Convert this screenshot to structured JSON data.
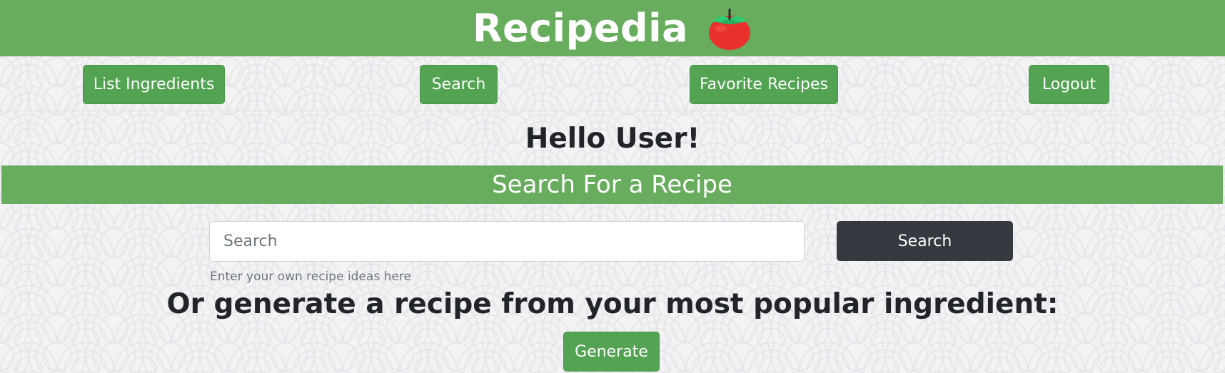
{
  "header": {
    "title": "Recipedia",
    "logo_icon": "tomato-icon",
    "bg_color": "#68ad5d"
  },
  "nav": {
    "items": [
      {
        "label": "List Ingredients"
      },
      {
        "label": "Search"
      },
      {
        "label": "Favorite Recipes"
      },
      {
        "label": "Logout"
      }
    ],
    "button_color": "#52a352"
  },
  "greeting": "Hello User!",
  "search_section": {
    "heading": "Search For a Recipe",
    "input": {
      "value": "",
      "placeholder": "Search"
    },
    "button_label": "Search",
    "button_color": "#343a40",
    "helper_text": "Enter your own recipe ideas here"
  },
  "generate_section": {
    "heading": "Or generate a recipe from your most popular ingredient:",
    "button_label": "Generate"
  }
}
